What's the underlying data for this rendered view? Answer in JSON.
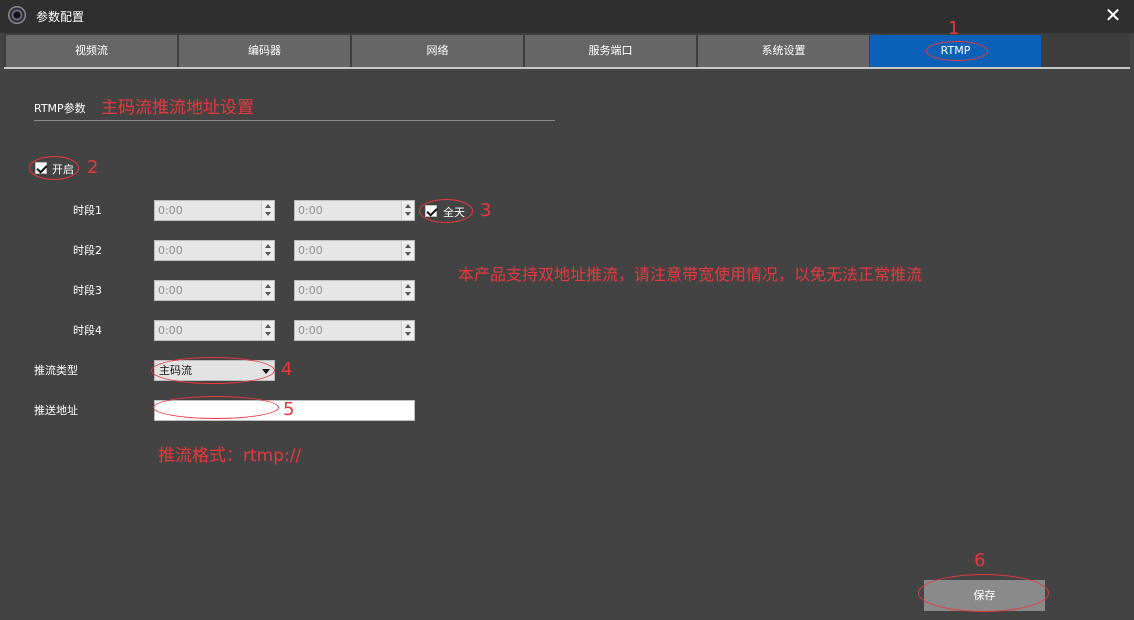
{
  "window": {
    "title": "参数配置",
    "close_glyph": "✕"
  },
  "tabs": [
    {
      "label": "视频流"
    },
    {
      "label": "编码器"
    },
    {
      "label": "网络"
    },
    {
      "label": "服务端口"
    },
    {
      "label": "系统设置"
    },
    {
      "label": "RTMP",
      "active": true
    }
  ],
  "section": {
    "label": "RTMP参数"
  },
  "enable": {
    "label": "开启",
    "checked": true
  },
  "periods": [
    {
      "label": "时段1",
      "start": "0:00",
      "end": "0:00"
    },
    {
      "label": "时段2",
      "start": "0:00",
      "end": "0:00"
    },
    {
      "label": "时段3",
      "start": "0:00",
      "end": "0:00"
    },
    {
      "label": "时段4",
      "start": "0:00",
      "end": "0:00"
    }
  ],
  "all_day": {
    "label": "全天",
    "checked": true
  },
  "stream_type": {
    "label": "推流类型",
    "value": "主码流"
  },
  "push_address": {
    "label": "推送地址",
    "value": ""
  },
  "save_button": {
    "label": "保存"
  },
  "annotations": {
    "heading": "主码流推流地址设置",
    "notice": "本产品支持双地址推流，请注意带宽使用情况，以免无法正常推流",
    "format": "推流格式：rtmp://",
    "markers": [
      "1",
      "2",
      "3",
      "4",
      "5",
      "6"
    ]
  },
  "colors": {
    "background": "#434343",
    "titlebar": "#2f2f2f",
    "tab_inactive": "#666666",
    "tab_active": "#0a61b7",
    "annotation": "#e8383d",
    "save_button": "#8a8a8a"
  },
  "icons": {
    "app": "camera-lens-icon",
    "close": "close-icon"
  }
}
